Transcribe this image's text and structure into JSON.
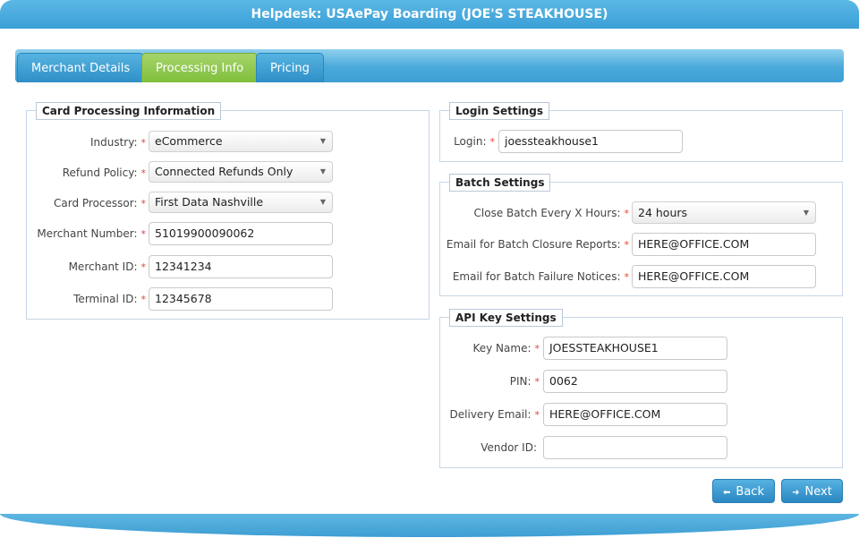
{
  "window": {
    "title": "Helpdesk: USAePay Boarding (JOE'S STEAKHOUSE)"
  },
  "tabs": [
    {
      "label": "Merchant Details"
    },
    {
      "label": "Processing Info"
    },
    {
      "label": "Pricing"
    }
  ],
  "card_processing": {
    "legend": "Card Processing Information",
    "industry": {
      "label": "Industry:",
      "value": "eCommerce"
    },
    "refund_policy": {
      "label": "Refund Policy:",
      "value": "Connected Refunds Only"
    },
    "card_processor": {
      "label": "Card Processor:",
      "value": "First Data Nashville"
    },
    "merchant_number": {
      "label": "Merchant Number:",
      "value": "51019900090062"
    },
    "merchant_id": {
      "label": "Merchant ID:",
      "value": "12341234"
    },
    "terminal_id": {
      "label": "Terminal ID:",
      "value": "12345678"
    }
  },
  "login_settings": {
    "legend": "Login Settings",
    "login": {
      "label": "Login:",
      "value": "joessteakhouse1"
    }
  },
  "batch_settings": {
    "legend": "Batch Settings",
    "close_batch": {
      "label": "Close Batch Every X Hours:",
      "value": "24 hours"
    },
    "closure_email": {
      "label": "Email for Batch Closure Reports:",
      "value": "HERE@OFFICE.COM"
    },
    "failure_email": {
      "label": "Email for Batch Failure Notices:",
      "value": "HERE@OFFICE.COM"
    }
  },
  "api_key_settings": {
    "legend": "API Key Settings",
    "key_name": {
      "label": "Key Name:",
      "value": "JOESSTEAKHOUSE1"
    },
    "pin": {
      "label": "PIN:",
      "value": "0062"
    },
    "delivery_email": {
      "label": "Delivery Email:",
      "value": "HERE@OFFICE.COM"
    },
    "vendor_id": {
      "label": "Vendor ID:",
      "value": ""
    }
  },
  "required_marker": "*",
  "buttons": {
    "back": "Back",
    "next": "Next"
  },
  "colors": {
    "accent_blue": "#3a9fd6",
    "active_tab_green": "#8cc84b",
    "required": "#e0453b"
  }
}
